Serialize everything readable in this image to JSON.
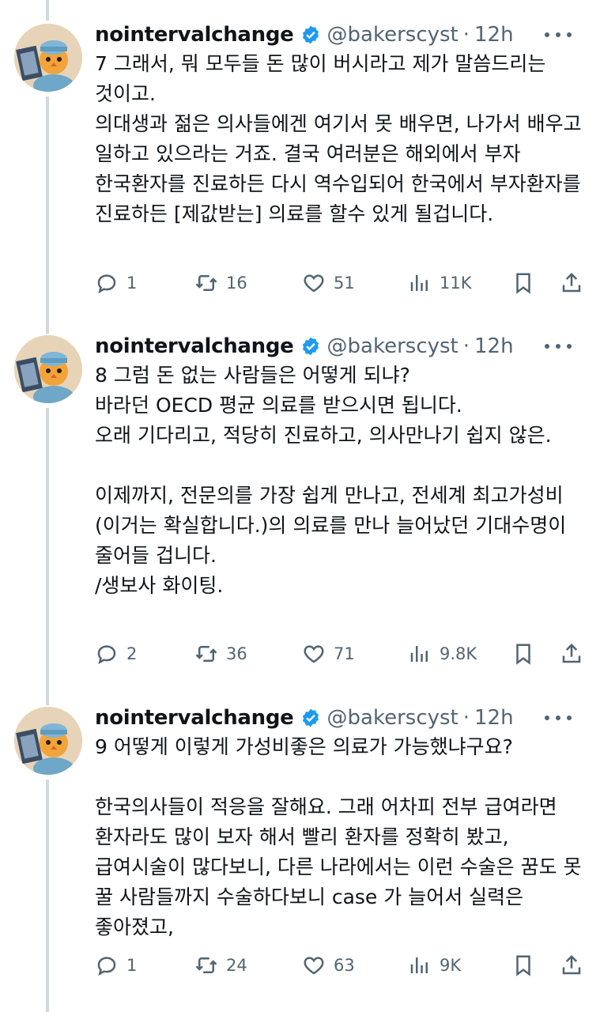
{
  "tweets": [
    {
      "name": "nointervalchange",
      "handle": "@bakerscyst",
      "dot": "·",
      "time": "12h",
      "text": "7 그래서, 뭐 모두들 돈 많이 버시라고 제가 말씀드리는 것이고.\n의대생과 젊은 의사들에겐 여기서 못 배우면, 나가서 배우고 일하고 있으라는 거죠. 결국 여러분은 해외에서 부자 한국환자를 진료하든 다시 역수입되어 한국에서 부자환자를 진료하든 [제값받는] 의료를 할수 있게 될겁니다.",
      "replies": "1",
      "retweets": "16",
      "likes": "51",
      "views": "11K"
    },
    {
      "name": "nointervalchange",
      "handle": "@bakerscyst",
      "dot": "·",
      "time": "12h",
      "text": "8 그럼 돈 없는 사람들은 어떻게 되냐?\n바라던 OECD 평균 의료를 받으시면 됩니다.\n오래 기다리고, 적당히 진료하고, 의사만나기 쉽지 않은.\n\n이제까지, 전문의를 가장 쉽게 만나고, 전세계 최고가성비 (이거는 확실합니다.)의 의료를 만나 늘어났던 기대수명이 줄어들 겁니다.\n/생보사 화이팅.",
      "replies": "2",
      "retweets": "36",
      "likes": "71",
      "views": "9.8K"
    },
    {
      "name": "nointervalchange",
      "handle": "@bakerscyst",
      "dot": "·",
      "time": "12h",
      "text": "9 어떻게 이렇게 가성비좋은 의료가 가능했냐구요?\n\n한국의사들이 적응을 잘해요. 그래 어차피 전부 급여라면 환자라도 많이 보자 해서 빨리 환자를 정확히 봤고, 급여시술이 많다보니, 다른 나라에서는 이런 수술은 꿈도 못 꿀 사람들까지 수술하다보니 case 가 늘어서 실력은 좋아졌고,",
      "replies": "1",
      "retweets": "24",
      "likes": "63",
      "views": "9K"
    }
  ],
  "icons": {
    "reply": "reply-icon",
    "retweet": "retweet-icon",
    "like": "like-icon",
    "views": "views-icon",
    "bookmark": "bookmark-icon",
    "share": "share-icon",
    "verified": "verified-badge-icon",
    "more": "more-icon"
  },
  "colors": {
    "verified": "#1d9bf0",
    "secondary_text": "#536471",
    "thread_line": "#cfd9de"
  }
}
